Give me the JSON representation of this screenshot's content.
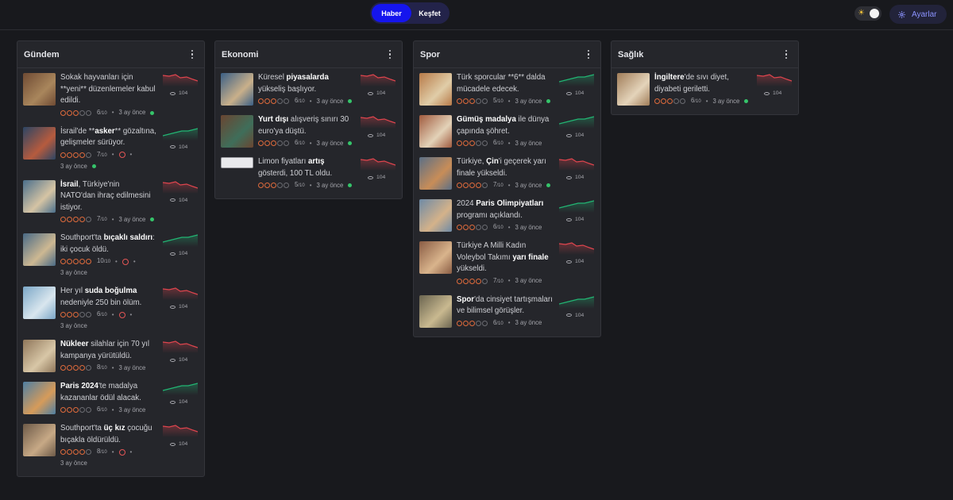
{
  "nav": {
    "tabs": [
      {
        "label": "Haber",
        "active": true
      },
      {
        "label": "Keşfet",
        "active": false
      }
    ],
    "settings_label": "Ayarlar"
  },
  "colors": {
    "accent": "#1515ee",
    "trend_up": "#22b573",
    "trend_down": "#e0454e",
    "rating": "#e06b3c",
    "status_green": "#35c46a"
  },
  "columns": [
    {
      "title": "Gündem",
      "items": [
        {
          "text": "Sokak hayvanları için **yeni** düzenlemeler kabul edildi.",
          "bold": [],
          "rating": 6,
          "time": "3 ay önce",
          "views": "104",
          "trend": "down",
          "sad": false,
          "live": true,
          "thumb": [
            "#6e4a33",
            "#a9865c"
          ]
        },
        {
          "text": "İsrail'de **asker** gözaltına, gelişmeler sürüyor.",
          "bold": [
            "asker"
          ],
          "rating": 7,
          "time": "3 ay önce",
          "views": "104",
          "trend": "up",
          "sad": true,
          "live": true,
          "thumb": [
            "#2b4564",
            "#b65b3e"
          ]
        },
        {
          "text": "İsrail, Türkiye'nin NATO'dan ihraç edilmesini istiyor.",
          "bold": [
            "İsrail"
          ],
          "rating": 7,
          "time": "3 ay önce",
          "views": "104",
          "trend": "down",
          "sad": false,
          "live": true,
          "thumb": [
            "#4a6f8c",
            "#d5c4a4"
          ]
        },
        {
          "text": "Southport'ta bıçaklı saldırı: iki çocuk öldü.",
          "bold": [
            "bıçaklı saldırı"
          ],
          "rating": 10,
          "time": "3 ay önce",
          "views": "104",
          "trend": "up",
          "sad": true,
          "live": false,
          "thumb": [
            "#496a86",
            "#cdb892"
          ]
        },
        {
          "text": "Her yıl suda boğulma nedeniyle 250 bin ölüm.",
          "bold": [
            "suda boğulma"
          ],
          "rating": 6,
          "time": "3 ay önce",
          "views": "104",
          "trend": "down",
          "sad": true,
          "live": false,
          "thumb": [
            "#7ba7c7",
            "#d9e6ee"
          ]
        },
        {
          "text": "Nükleer silahlar için 70 yıl kampanya yürütüldü.",
          "bold": [
            "Nükleer"
          ],
          "rating": 8,
          "time": "3 ay önce",
          "views": "104",
          "trend": "down",
          "sad": false,
          "live": false,
          "thumb": [
            "#8f765a",
            "#d8c7a7"
          ]
        },
        {
          "text": "Paris 2024'te madalya kazananlar ödül alacak.",
          "bold": [
            "Paris 2024"
          ],
          "rating": 6,
          "time": "3 ay önce",
          "views": "104",
          "trend": "up",
          "sad": false,
          "live": false,
          "thumb": [
            "#4e7fa3",
            "#d69b5a"
          ]
        },
        {
          "text": "Southport'ta üç kız çocuğu bıçakla öldürüldü.",
          "bold": [
            "üç kız"
          ],
          "rating": 8,
          "time": "3 ay önce",
          "views": "104",
          "trend": "down",
          "sad": true,
          "live": false,
          "thumb": [
            "#6d5a48",
            "#c7a986"
          ]
        }
      ]
    },
    {
      "title": "Ekonomi",
      "items": [
        {
          "text": "Küresel piyasalarda yükseliş başlıyor.",
          "bold": [
            "piyasalarda"
          ],
          "rating": 6,
          "time": "3 ay önce",
          "views": "104",
          "trend": "down",
          "sad": false,
          "live": true,
          "thumb": [
            "#3a5f86",
            "#c9b08a"
          ]
        },
        {
          "text": "Yurt dışı alışveriş sınırı 30 euro'ya düştü.",
          "bold": [
            "Yurt dışı"
          ],
          "rating": 6,
          "time": "3 ay önce",
          "views": "104",
          "trend": "down",
          "sad": false,
          "live": true,
          "thumb": [
            "#6a4531",
            "#3f6e5a"
          ]
        },
        {
          "text": "Limon fiyatları artış gösterdi, 100 TL oldu.",
          "bold": [
            "artış"
          ],
          "rating": 5,
          "time": "3 ay önce",
          "views": "104",
          "trend": "down",
          "sad": false,
          "live": true,
          "thumb": null
        }
      ]
    },
    {
      "title": "Spor",
      "items": [
        {
          "text": "Türk sporcular **6** dalda mücadele edecek.",
          "bold": [],
          "rating": 5,
          "time": "3 ay önce",
          "views": "104",
          "trend": "up",
          "sad": false,
          "live": true,
          "thumb": [
            "#b77a48",
            "#e0cda8"
          ]
        },
        {
          "text": "Gümüş madalya ile dünya çapında şöhret.",
          "bold": [
            "Gümüş madalya"
          ],
          "rating": 6,
          "time": "3 ay önce",
          "views": "104",
          "trend": "up",
          "sad": false,
          "live": false,
          "thumb": [
            "#a05a3e",
            "#e3d2b8"
          ]
        },
        {
          "text": "Türkiye, Çin'i geçerek yarı finale yükseldi.",
          "bold": [
            "Çin"
          ],
          "rating": 7,
          "time": "3 ay önce",
          "views": "104",
          "trend": "down",
          "sad": false,
          "live": true,
          "thumb": [
            "#5b6f86",
            "#c88d58"
          ]
        },
        {
          "text": "2024 Paris Olimpiyatları programı açıklandı.",
          "bold": [
            "Paris Olimpiyatları"
          ],
          "rating": 6,
          "time": "3 ay önce",
          "views": "104",
          "trend": "up",
          "sad": false,
          "live": false,
          "thumb": [
            "#6e8aa6",
            "#d4b28a"
          ]
        },
        {
          "text": "Türkiye A Milli Kadın Voleybol Takımı yarı finale yükseldi.",
          "bold": [
            "yarı finale"
          ],
          "rating": 7,
          "time": "3 ay önce",
          "views": "104",
          "trend": "down",
          "sad": false,
          "live": false,
          "thumb": [
            "#8a5c44",
            "#d9b48c"
          ]
        },
        {
          "text": "Spor'da cinsiyet tartışmaları ve bilimsel görüşler.",
          "bold": [
            "Spor"
          ],
          "rating": 6,
          "time": "3 ay önce",
          "views": "104",
          "trend": "up",
          "sad": false,
          "live": false,
          "thumb": [
            "#6b6550",
            "#c9b990"
          ]
        }
      ]
    },
    {
      "title": "Sağlık",
      "items": [
        {
          "text": "İngiltere'de sıvı diyet, diyabeti geriletti.",
          "bold": [
            "İngiltere"
          ],
          "rating": 6,
          "time": "3 ay önce",
          "views": "104",
          "trend": "down",
          "sad": false,
          "live": true,
          "thumb": [
            "#a07c58",
            "#e4d4ba"
          ]
        }
      ]
    }
  ]
}
